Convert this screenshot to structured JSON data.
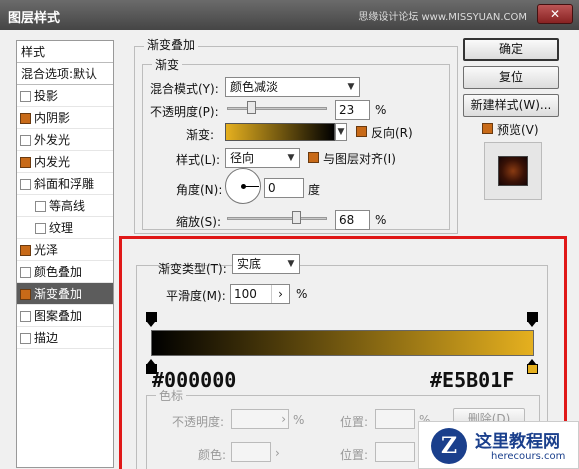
{
  "window": {
    "title": "图层样式",
    "watermark": "思缘设计论坛 www.MISSYUAN.COM",
    "close_glyph": "✕"
  },
  "styles_list": {
    "header": "样式",
    "blend_default": "混合选项:默认",
    "items": [
      {
        "label": "投影",
        "checked": false,
        "sub": false
      },
      {
        "label": "内阴影",
        "checked": true,
        "sub": false
      },
      {
        "label": "外发光",
        "checked": false,
        "sub": false
      },
      {
        "label": "内发光",
        "checked": true,
        "sub": false
      },
      {
        "label": "斜面和浮雕",
        "checked": false,
        "sub": false
      },
      {
        "label": "等高线",
        "checked": false,
        "sub": true
      },
      {
        "label": "纹理",
        "checked": false,
        "sub": true
      },
      {
        "label": "光泽",
        "checked": true,
        "sub": false
      },
      {
        "label": "颜色叠加",
        "checked": false,
        "sub": false
      },
      {
        "label": "渐变叠加",
        "checked": true,
        "sub": false,
        "selected": true
      },
      {
        "label": "图案叠加",
        "checked": false,
        "sub": false
      },
      {
        "label": "描边",
        "checked": false,
        "sub": false
      }
    ]
  },
  "gradient_overlay": {
    "group_title": "渐变叠加",
    "sub_title": "渐变",
    "blend_mode_label": "混合模式(Y):",
    "blend_mode_value": "颜色减淡",
    "opacity_label": "不透明度(P):",
    "opacity_value": "23",
    "opacity_percent": 23,
    "gradient_label": "渐变:",
    "reverse_label": "反向(R)",
    "reverse_checked": true,
    "style_label": "样式(L):",
    "style_value": "径向",
    "align_label": "与图层对齐(I)",
    "align_checked": true,
    "angle_label": "角度(N):",
    "angle_value": "0",
    "angle_unit": "度",
    "scale_label": "缩放(S):",
    "scale_value": "68",
    "scale_percent": 68,
    "percent_sign": "%"
  },
  "right_buttons": {
    "ok": "确定",
    "reset": "复位",
    "new_style": "新建样式(W)...",
    "preview_label": "预览(V)",
    "preview_checked": true
  },
  "gradient_editor": {
    "type_label": "渐变类型(T):",
    "type_value": "实底",
    "smoothness_label": "平滑度(M):",
    "smoothness_value": "100",
    "stepper_glyph": "›",
    "percent_sign": "%",
    "color_left": "#000000",
    "color_right": "#E5B01F",
    "color_left_label": "#000000",
    "color_right_label": "#E5B01F",
    "stops_group_label": "色标",
    "stop_opacity_label": "不透明度:",
    "stop_color_label": "颜色:",
    "position_label": "位置:",
    "delete_button": "删除(D)"
  },
  "logo": {
    "mark": "Z",
    "name": "这里教程网",
    "url": "herecours.com"
  },
  "colors": {
    "accent_checkbox": "#c86a18",
    "highlight_red": "#e01818",
    "list_selected": "#5c5c5c",
    "logo_blue": "#1a3f8c"
  }
}
